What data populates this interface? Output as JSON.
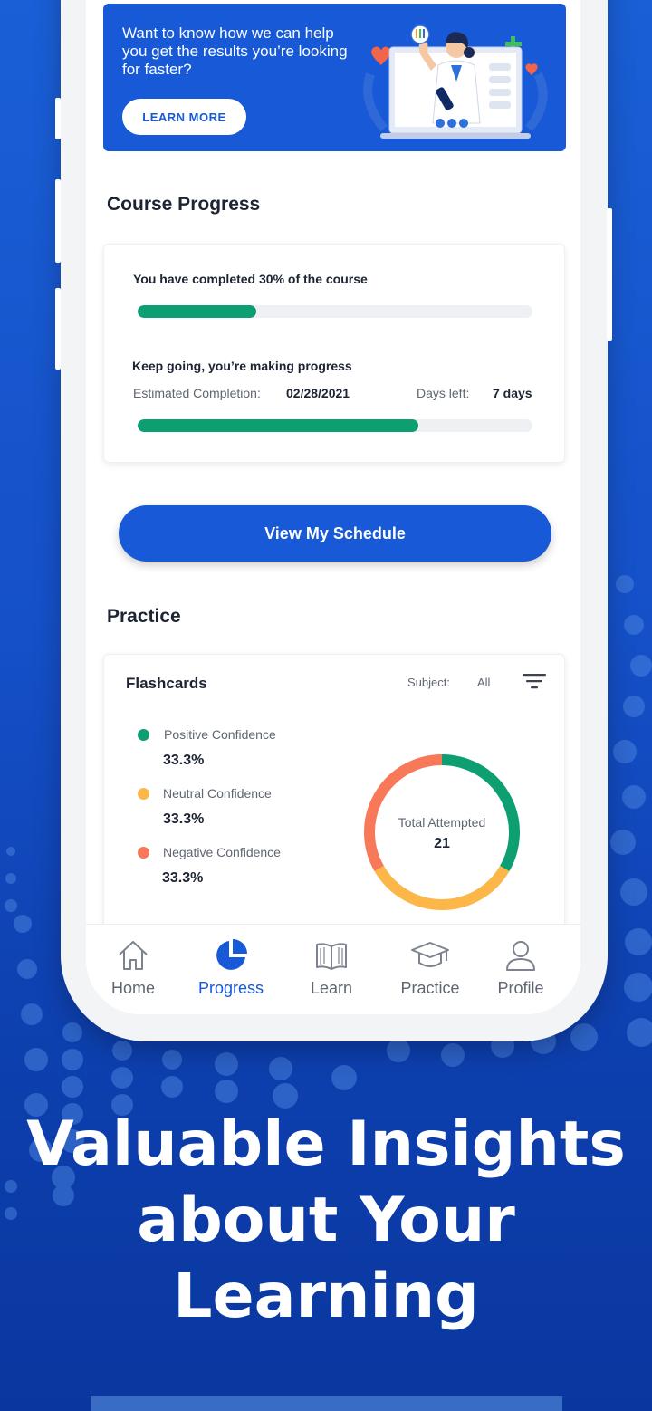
{
  "banner": {
    "text": "Want to know how we can help you get the results you’re looking for faster?",
    "button_label": "LEARN MORE"
  },
  "course_progress": {
    "title": "Course Progress",
    "completed_text": "You have completed 30% of the course",
    "completed_fraction": 0.3,
    "encourage_text": "Keep going, you’re making progress",
    "estimated_label": "Estimated Completion:",
    "estimated_value": "02/28/2021",
    "days_left_label": "Days left:",
    "days_left_value": "7 days",
    "schedule_fraction": 0.71
  },
  "schedule_button_label": "View My Schedule",
  "practice": {
    "title": "Practice",
    "card_title": "Flashcards",
    "subject_label": "Subject:",
    "subject_value": "All",
    "filter_icon": "filter-icon",
    "legend": [
      {
        "label": "Positive Confidence",
        "value": "33.3%",
        "color": "#0d9f72"
      },
      {
        "label": "Neutral Confidence",
        "value": "33.3%",
        "color": "#fdb748"
      },
      {
        "label": "Negative Confidence",
        "value": "33.3%",
        "color": "#f8785a"
      }
    ],
    "donut_label": "Total Attempted",
    "donut_value": "21"
  },
  "nav": {
    "items": [
      {
        "label": "Home",
        "icon": "home-icon",
        "active": false
      },
      {
        "label": "Progress",
        "icon": "pie-chart-icon",
        "active": true
      },
      {
        "label": "Learn",
        "icon": "book-icon",
        "active": false
      },
      {
        "label": "Practice",
        "icon": "graduation-cap-icon",
        "active": false
      },
      {
        "label": "Profile",
        "icon": "user-icon",
        "active": false
      }
    ]
  },
  "headline": {
    "line1": "Valuable Insights",
    "line2": "about Your",
    "line3": "Learning"
  }
}
